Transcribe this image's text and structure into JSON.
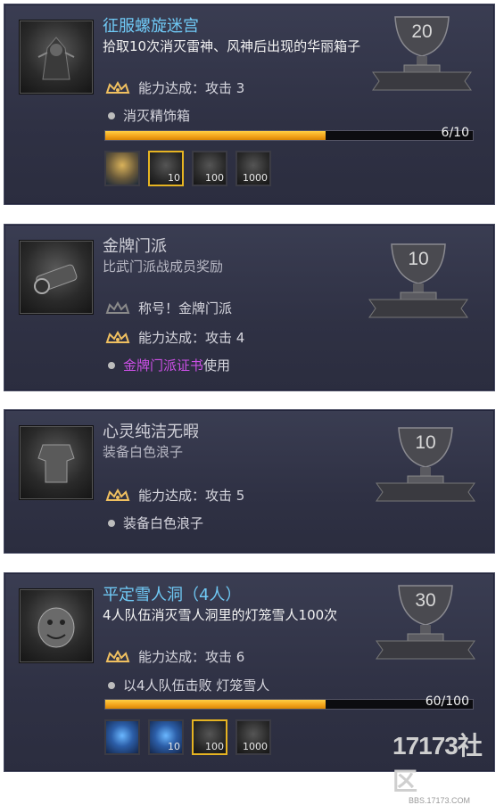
{
  "achievements": [
    {
      "title": "征服螺旋迷宫",
      "description": "拾取10次消灭雷神、风神后出现的华丽箱子",
      "ability": "能力达成：攻击 3",
      "condition": "消灭精饰箱",
      "progress_text": "6/10",
      "progress_fraction": 0.6,
      "points": "20",
      "rewards": [
        "",
        "10",
        "100",
        "1000"
      ]
    },
    {
      "title": "金牌门派",
      "description": "比武门派战成员奖励",
      "title_reward": "称号！金牌门派",
      "ability": "能力达成：攻击 4",
      "condition_link": "金牌门派证书",
      "condition_suffix": "使用",
      "points": "10"
    },
    {
      "title": "心灵纯洁无暇",
      "description": "装备白色浪子",
      "ability": "能力达成：攻击 5",
      "condition": "装备白色浪子",
      "points": "10"
    },
    {
      "title": "平定雪人洞（4人）",
      "description": "4人队伍消灭雪人洞里的灯笼雪人100次",
      "ability": "能力达成：攻击 6",
      "condition": "以4人队伍击败 灯笼雪人",
      "progress_text": "60/100",
      "progress_fraction": 0.6,
      "points": "30",
      "rewards": [
        "",
        "10",
        "100",
        "1000"
      ]
    }
  ],
  "watermark": {
    "logo": "17173社区",
    "url": "BBS.17173.COM"
  },
  "colors": {
    "title_highlight": "#6fc9f5",
    "progress_fill": "#f4a51c",
    "link_purple": "#cc4fe6",
    "card_bg": "#2f3144"
  }
}
